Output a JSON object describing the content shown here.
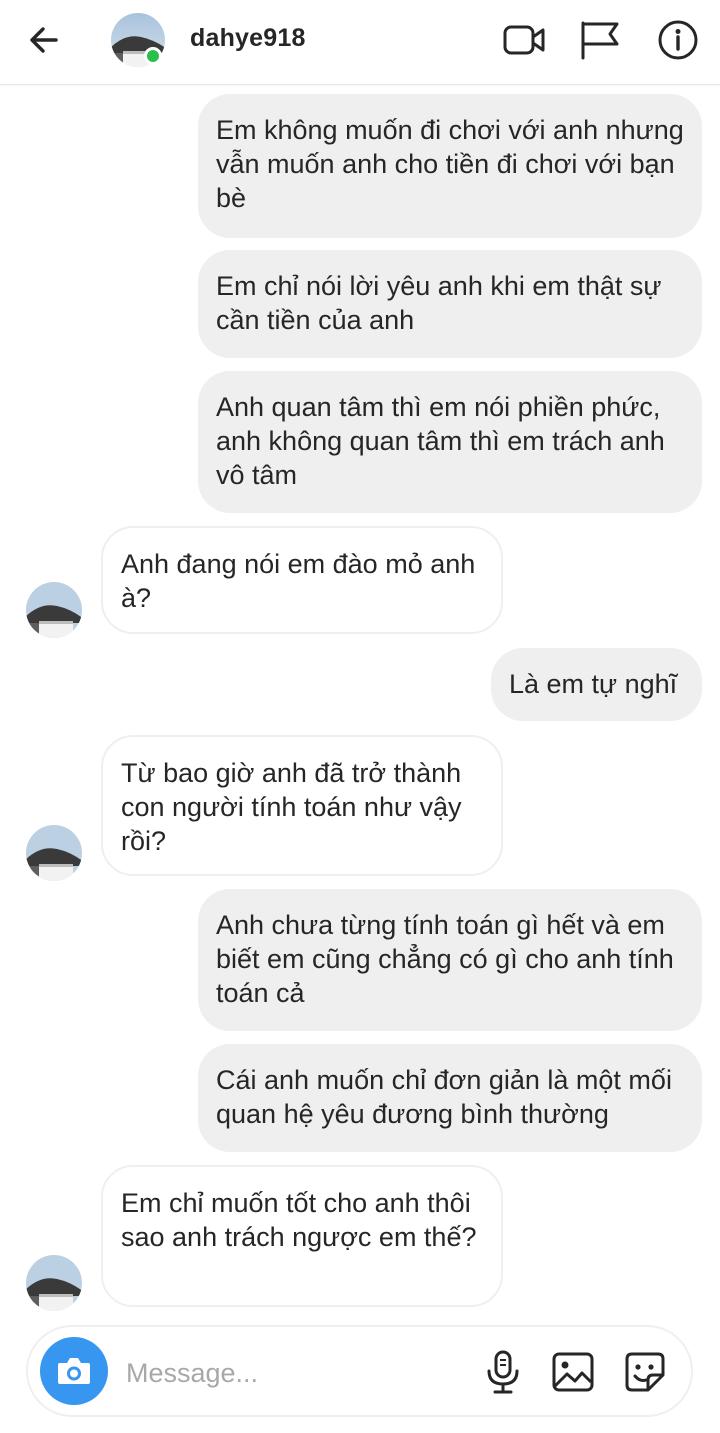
{
  "header": {
    "username": "dahye918",
    "icons": [
      "back-arrow-icon",
      "video-call-icon",
      "flag-icon",
      "info-icon"
    ],
    "online_color": "#29c04a"
  },
  "messages": [
    {
      "side": "out",
      "text": "Em không muốn đi chơi với anh nhưng vẫn muốn anh cho tiền đi chơi với bạn bè"
    },
    {
      "side": "out",
      "text": "Em chỉ nói lời yêu anh khi em thật sự cần tiền của anh"
    },
    {
      "side": "out",
      "text": "Anh quan tâm thì em nói phiền phức, anh không quan tâm thì em trách anh vô tâm"
    },
    {
      "side": "in",
      "text": "Anh đang nói em đào mỏ anh à?"
    },
    {
      "side": "out",
      "text": "Là em tự nghĩ"
    },
    {
      "side": "in",
      "text": "Từ bao giờ anh đã trở thành con người tính toán như vậy rồi?"
    },
    {
      "side": "out",
      "text": "Anh chưa từng tính toán gì hết và em biết em cũng chẳng có gì cho anh tính toán cả"
    },
    {
      "side": "out",
      "text": "Cái anh muốn chỉ đơn giản là một mối quan hệ yêu đương bình thường"
    },
    {
      "side": "in",
      "text": "Em chỉ muốn tốt cho anh thôi sao anh trách ngược em thế?"
    }
  ],
  "composer": {
    "placeholder": "Message...",
    "icons": [
      "camera-icon",
      "microphone-icon",
      "gallery-icon",
      "sticker-icon"
    ],
    "accent": "#3797f0"
  },
  "colors": {
    "outgoing_bubble": "#efefef",
    "incoming_border": "#efefef",
    "text": "#262626"
  }
}
